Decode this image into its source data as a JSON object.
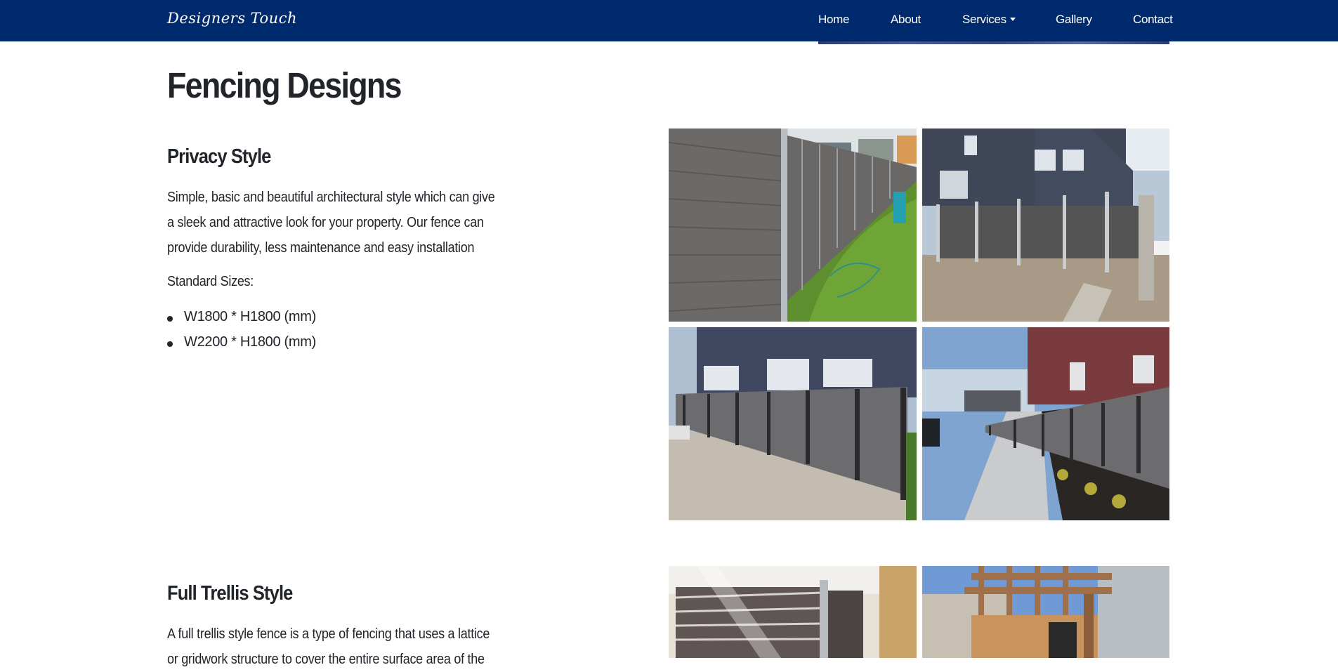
{
  "navbar": {
    "brand": "Designers Touch",
    "items": [
      "Home",
      "About",
      "Services",
      "Gallery",
      "Contact"
    ],
    "background": "#002a6e"
  },
  "page": {
    "title": "Fencing Designs"
  },
  "sections": [
    {
      "title": "Privacy Style",
      "description": "Simple, basic and beautiful architectural style which can give a sleek and attractive look for your property. Our fence can provide durability, less maintenance and easy installation",
      "sizes_label": "Standard Sizes:",
      "sizes": [
        "W1800 * H1800 (mm)",
        "W2200 * H1800 (mm)"
      ]
    },
    {
      "title": "Full Trellis Style",
      "description": "A full trellis style fence is a type of fencing that uses a lattice or gridwork structure to cover the entire surface area of the"
    }
  ]
}
